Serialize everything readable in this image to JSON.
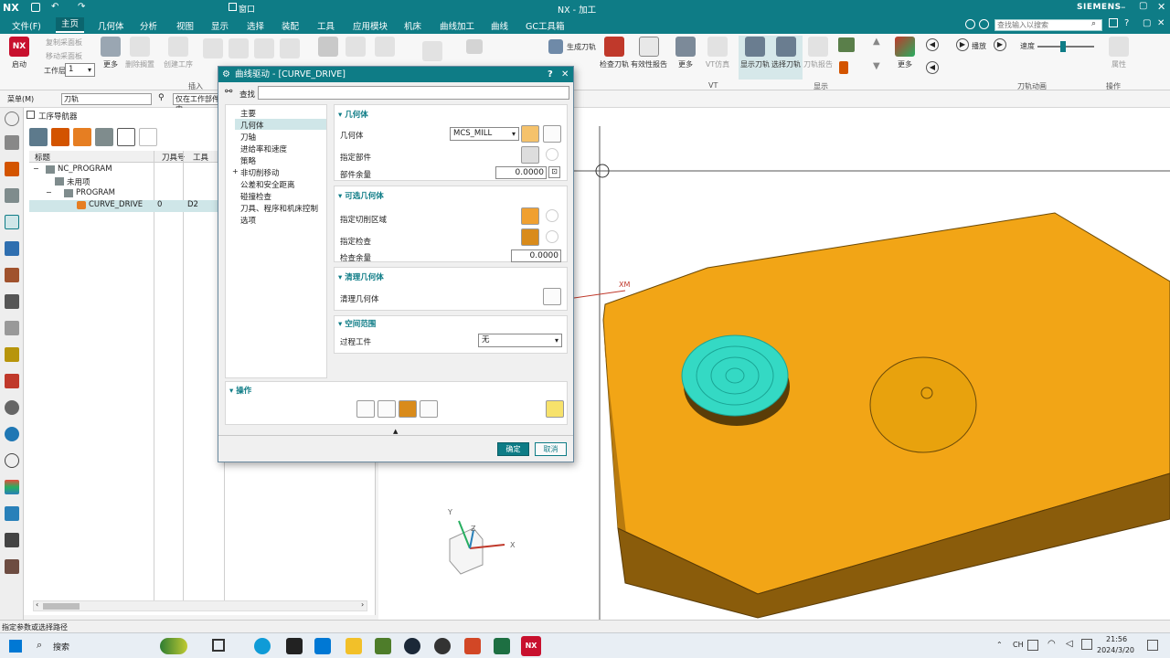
{
  "app": {
    "logo": "NX",
    "title": "NX - 加工",
    "brand": "SIEMENS",
    "window_menu": "窗口"
  },
  "menubar": {
    "items": [
      "文件(F)",
      "主页",
      "几何体",
      "分析",
      "视图",
      "显示",
      "选择",
      "装配",
      "工具",
      "应用模块",
      "机床",
      "曲线加工",
      "曲线",
      "GC工具箱"
    ],
    "active": "主页",
    "search_placeholder": "查找输入以搜索"
  },
  "ribbon": {
    "start": "启动",
    "copy_roughing": "复制采面板",
    "move_roughing": "移动采面板",
    "workspace_label": "工作层",
    "workspace_value": "1",
    "more": "更多",
    "delete_box": "删除搁置",
    "create_process": "创建工序",
    "insert_group": "插入",
    "generate_path": "生成刀轨",
    "check_tool": "检查刀轨",
    "validity_report": "有效性报告",
    "more2": "更多",
    "vt_sim": "VT仿真",
    "vt_group": "VT",
    "show_path": "显示刀轨",
    "select_path": "选择刀轨",
    "path_report": "刀轨报告",
    "display_group": "显示",
    "more3": "更多",
    "play": "播放",
    "speed": "速度",
    "animation_group": "刀轨动画",
    "operation_group": "操作",
    "attribute": "属性"
  },
  "toolbar2": {
    "menu": "菜单(M)",
    "filter": "刀轨",
    "scope": "仅在工作部件内"
  },
  "navigator": {
    "title": "工序导航器",
    "columns": [
      "标题",
      "刀具号",
      "工具"
    ],
    "rows": [
      {
        "name": "NC_PROGRAM",
        "tool_no": "",
        "tool": ""
      },
      {
        "name": "未用项",
        "tool_no": "",
        "tool": ""
      },
      {
        "name": "PROGRAM",
        "tool_no": "",
        "tool": ""
      },
      {
        "name": "CURVE_DRIVE",
        "tool_no": "0",
        "tool": "D2"
      }
    ]
  },
  "dialog": {
    "title": "曲线驱动 - [CURVE_DRIVE]",
    "help": "?",
    "close": "✕",
    "search_label": "查找",
    "search_value": "",
    "tree": [
      "主要",
      "几何体",
      "刀轴",
      "进给率和速度",
      "策略",
      "非切削移动",
      "公差和安全距离",
      "碰撞检查",
      "刀具、程序和机床控制",
      "选项"
    ],
    "tree_selected": "几何体",
    "geometry_section": "几何体",
    "geometry_label": "几何体",
    "geometry_value": "MCS_MILL",
    "specify_part": "指定部件",
    "part_stock": "部件余量",
    "part_stock_value": "0.0000",
    "optional_section": "可选几何体",
    "cut_area": "指定切削区域",
    "check_geom": "指定检查",
    "check_stock": "检查余量",
    "check_stock_value": "0.0000",
    "cleanup_section": "清理几何体",
    "cleanup_label": "清理几何体",
    "space_section": "空间范围",
    "process_work": "过程工件",
    "process_work_value": "无",
    "actions_section": "操作",
    "ok": "确定",
    "cancel": "取消"
  },
  "viewport": {
    "xm_label": "XM",
    "axis_x": "X",
    "axis_y": "Y",
    "axis_z": "Z"
  },
  "status": "指定参数或选择路径",
  "taskbar": {
    "search": "搜索",
    "ime": "CH",
    "time": "21:56",
    "date": "2024/3/20"
  },
  "colors": {
    "accent": "#0e7c86",
    "part": "#f2a516",
    "part_dark": "#8a5c0b",
    "toolpath": "#34d9c4"
  }
}
